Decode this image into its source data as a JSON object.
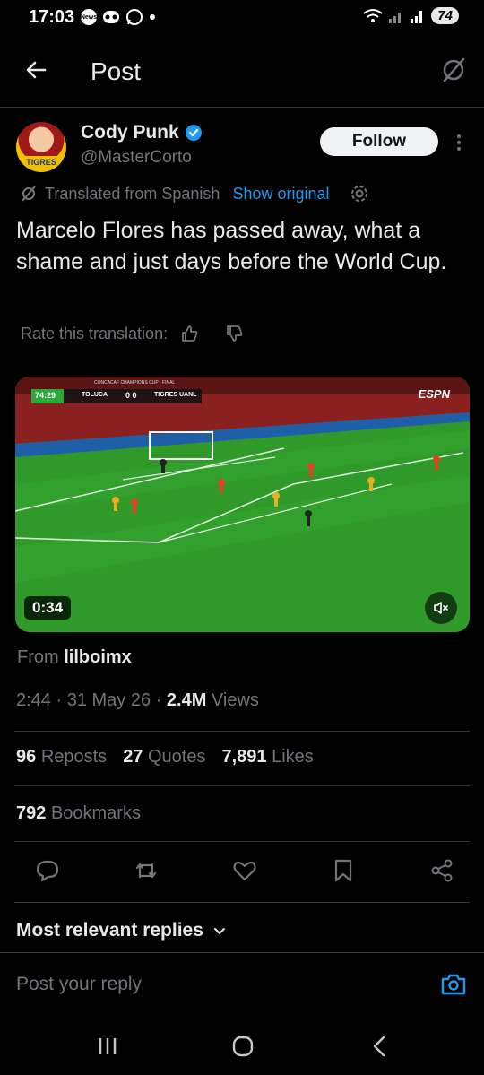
{
  "status_bar": {
    "time": "17:03",
    "battery": "74",
    "notif_badge": "News"
  },
  "header": {
    "title": "Post"
  },
  "author": {
    "name": "Cody Punk",
    "handle": "@MasterCorto",
    "avatar_text": "TIGRES",
    "follow_label": "Follow"
  },
  "translation": {
    "label": "Translated from Spanish",
    "show_original": "Show original"
  },
  "tweet": {
    "text": "Marcelo Flores has passed away, what a shame and just days before the World Cup."
  },
  "rate": {
    "label": "Rate this translation:"
  },
  "video": {
    "duration": "0:34",
    "scoreboard": {
      "clock": "74:29",
      "home": "TOLUCA",
      "score": "0 0",
      "away": "TIGRES UANL",
      "competition": "CONCACAF CHAMPIONS CUP · FINAL"
    },
    "broadcaster": "ESPN"
  },
  "source": {
    "prefix": "From",
    "user": "lilboimx"
  },
  "meta": {
    "time": "2:44",
    "date": "31 May 26",
    "views_count": "2.4M",
    "views_label": "Views"
  },
  "stats": {
    "reposts_count": "96",
    "reposts_label": "Reposts",
    "quotes_count": "27",
    "quotes_label": "Quotes",
    "likes_count": "7,891",
    "likes_label": "Likes",
    "bookmarks_count": "792",
    "bookmarks_label": "Bookmarks"
  },
  "replies": {
    "sort_label": "Most relevant replies",
    "placeholder": "Post your reply"
  },
  "colors": {
    "accent": "#1d9bf0",
    "background": "#000000",
    "muted": "#71767b",
    "text": "#e7e9ea"
  }
}
